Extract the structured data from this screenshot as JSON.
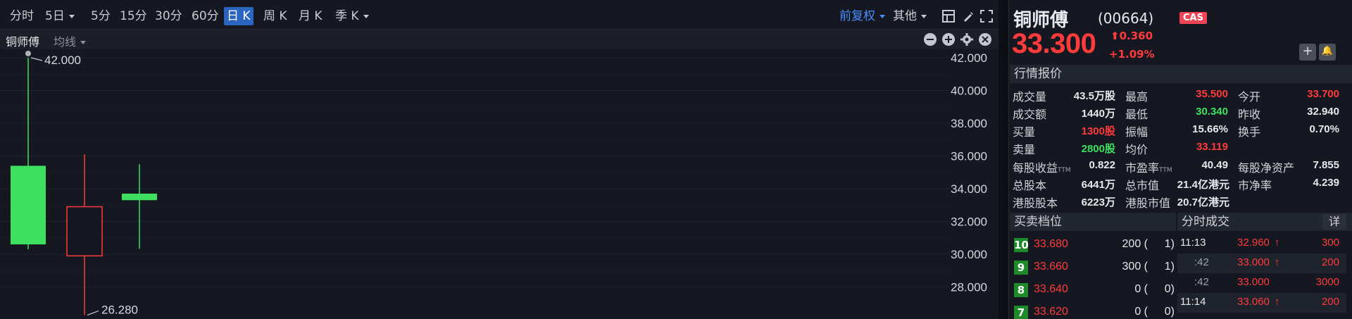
{
  "periods": [
    "分时",
    "5日",
    "5分",
    "15分",
    "30分",
    "60分",
    "日 K",
    "周 K",
    "月 K",
    "季 K"
  ],
  "adjust": "前复权",
  "other": "其他",
  "indicator": {
    "stock": "铜师傅",
    "ma": "均线"
  },
  "chart_data": {
    "type": "candlestick",
    "yticks": [
      "42.000",
      "40.000",
      "38.000",
      "36.000",
      "34.000",
      "32.000",
      "30.000",
      "28.000"
    ],
    "ylim": [
      26.28,
      42.0
    ],
    "candles": [
      {
        "open": 30.6,
        "close": 35.4,
        "high": 42.0,
        "low": 30.3,
        "dir": "up"
      },
      {
        "open": 32.9,
        "close": 29.9,
        "high": 36.1,
        "low": 26.28,
        "dir": "down"
      },
      {
        "open": 33.7,
        "close": 33.3,
        "high": 35.5,
        "low": 30.34,
        "dir": "up"
      }
    ],
    "annotations": {
      "high": "42.000",
      "low": "26.280"
    }
  },
  "quote": {
    "name": "铜师傅",
    "code": "(00664)",
    "badge": "CAS",
    "price": "33.300",
    "change": "0.360",
    "change_pct": "+1.09%",
    "add_btn": "+",
    "alert_btn": "🔔",
    "section_quote": "行情报价",
    "rows": [
      [
        {
          "l": "成交量",
          "v": "43.5万股",
          "c": "white"
        },
        {
          "l": "最高",
          "v": "35.500",
          "c": "red"
        },
        {
          "l": "今开",
          "v": "33.700",
          "c": "red"
        }
      ],
      [
        {
          "l": "成交额",
          "v": "1440万",
          "c": "white"
        },
        {
          "l": "最低",
          "v": "30.340",
          "c": "green"
        },
        {
          "l": "昨收",
          "v": "32.940",
          "c": "white"
        }
      ],
      [
        {
          "l": "买量",
          "v": "1300股",
          "c": "red"
        },
        {
          "l": "振幅",
          "v": "15.66%",
          "c": "white"
        },
        {
          "l": "换手",
          "v": "0.70%",
          "c": "white"
        }
      ],
      [
        {
          "l": "卖量",
          "v": "2800股",
          "c": "green"
        },
        {
          "l": "均价",
          "v": "33.119",
          "c": "red"
        }
      ]
    ],
    "rows2": [
      [
        {
          "l": "每股收益",
          "ttm": "TTM",
          "v": "0.822"
        },
        {
          "l": "市盈率",
          "ttm": "TTM",
          "v": "40.49"
        },
        {
          "l": "每股净资产",
          "v": "7.855"
        }
      ],
      [
        {
          "l": "总股本",
          "v": "6441万"
        },
        {
          "l": "总市值",
          "v": "21.4亿港元"
        },
        {
          "l": "市净率",
          "v": "4.239"
        }
      ],
      [
        {
          "l": "港股股本",
          "v": "6223万"
        },
        {
          "l": "港股市值",
          "v": "20.7亿港元"
        }
      ]
    ],
    "section_book": "买卖档位",
    "section_ticks": "分时成交",
    "detail": "详",
    "book": [
      {
        "lvl": "10",
        "price": "33.680",
        "vol": "200",
        "cnt": "1"
      },
      {
        "lvl": "9",
        "price": "33.660",
        "vol": "300",
        "cnt": "1"
      },
      {
        "lvl": "8",
        "price": "33.640",
        "vol": "0",
        "cnt": "0"
      },
      {
        "lvl": "7",
        "price": "33.620",
        "vol": "0",
        "cnt": "0"
      }
    ],
    "ticks": [
      {
        "time": "11:13",
        "price": "32.960",
        "arrow": "up",
        "vol": "300"
      },
      {
        "time": ":42",
        "price": "33.000",
        "arrow": "up",
        "vol": "200"
      },
      {
        "time": ":42",
        "price": "33.000",
        "arrow": "",
        "vol": "3000"
      },
      {
        "time": "11:14",
        "price": "33.060",
        "arrow": "up",
        "vol": "200"
      }
    ]
  }
}
